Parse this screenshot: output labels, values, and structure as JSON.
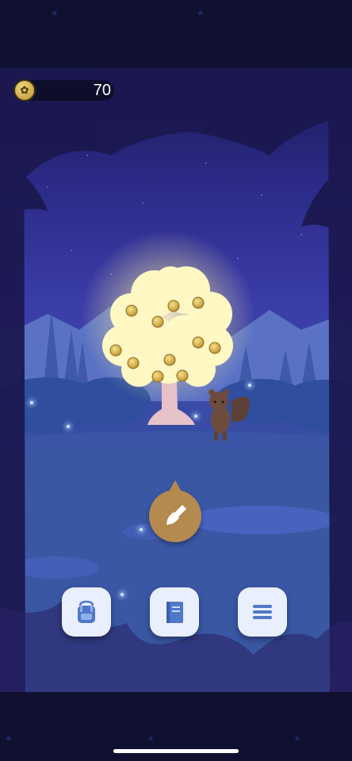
{
  "header": {
    "coin_balance": "70",
    "coin_icon": "coin-sprout-icon"
  },
  "scene": {
    "tree": "golden-money-tree",
    "character": "squirrel",
    "coins_on_tree": 10
  },
  "actions": {
    "dig": {
      "icon": "shovel-icon"
    },
    "bottom_menu": [
      {
        "icon": "backpack-icon"
      },
      {
        "icon": "book-icon"
      },
      {
        "icon": "hamburger-menu-icon"
      }
    ]
  },
  "colors": {
    "coin_gold": "#d4b04e",
    "dig_button": "#b58a4f",
    "menu_button_bg": "#e9effc",
    "menu_icon": "#4f78c9",
    "night_sky": "#2b2a86"
  }
}
